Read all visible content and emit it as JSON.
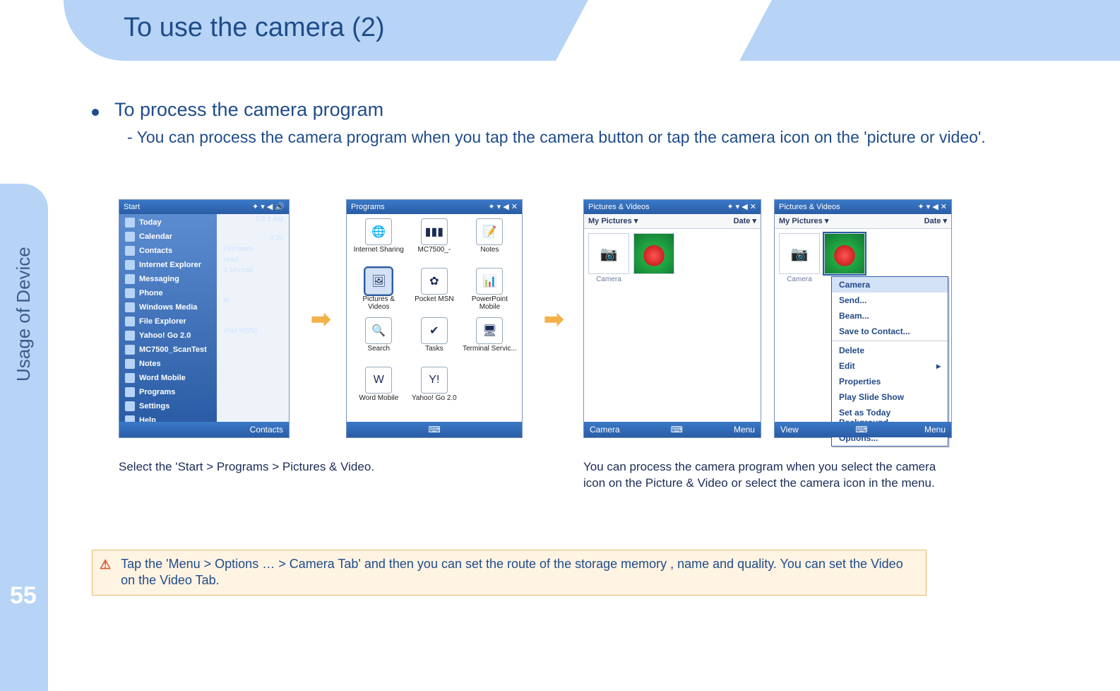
{
  "side": {
    "label": "Usage of Device",
    "page": "55"
  },
  "header": {
    "title": "To use the camera (2)"
  },
  "bullet": {
    "heading": "To process the camera program"
  },
  "subline": "- You can process the camera program when you tap the camera button or tap the camera icon on the 'picture or video'.",
  "shots": {
    "start": {
      "title": "Start",
      "status_icons": "✦ ▾ ◀ 🔊",
      "items": [
        "Today",
        "Calendar",
        "Contacts",
        "Internet Explorer",
        "Messaging",
        "Phone",
        "Windows Media",
        "File Explorer",
        "Yahoo! Go 2.0",
        "MC7500_ScanTest",
        "Notes",
        "Word Mobile",
        "Programs",
        "Settings",
        "Help"
      ],
      "right_hints": [
        "1/2 1 AM",
        "0:20",
        "Firmware",
        "read",
        "1 Unread",
        "ts",
        "chet MSN)"
      ],
      "bottom": "Contacts"
    },
    "programs": {
      "title": "Programs",
      "status_icons": "✦ ▾ ◀ ✕",
      "apps": [
        {
          "lbl": "Internet Sharing",
          "glyph": "🌐"
        },
        {
          "lbl": "MC7500_-",
          "glyph": "▮▮▮"
        },
        {
          "lbl": "Notes",
          "glyph": "📝"
        },
        {
          "lbl": "Pictures & Videos",
          "glyph": "🖼",
          "selected": true
        },
        {
          "lbl": "Pocket MSN",
          "glyph": "✿"
        },
        {
          "lbl": "PowerPoint Mobile",
          "glyph": "📊"
        },
        {
          "lbl": "Search",
          "glyph": "🔍"
        },
        {
          "lbl": "Tasks",
          "glyph": "✔"
        },
        {
          "lbl": "Terminal Servic...",
          "glyph": "🖥"
        },
        {
          "lbl": "Word Mobile",
          "glyph": "W"
        },
        {
          "lbl": "Yahoo! Go 2.0",
          "glyph": "Y!"
        }
      ]
    },
    "pv1": {
      "title": "Pictures & Videos",
      "status_icons": "✦ ▾ ◀ ✕",
      "folder": "My Pictures",
      "sort": "Date",
      "camera_tile": "Camera",
      "bottom_left": "Camera",
      "bottom_right": "Menu"
    },
    "pv2": {
      "title": "Pictures & Videos",
      "status_icons": "✦ ▾ ◀ ✕",
      "folder": "My Pictures",
      "sort": "Date",
      "camera_tile": "Camera",
      "bottom_left": "View",
      "bottom_right": "Menu",
      "menu": [
        "Camera",
        "Send...",
        "Beam...",
        "Save to Contact...",
        "Delete",
        "Edit",
        "Properties",
        "Play Slide Show",
        "Set as Today Background...",
        "Options..."
      ]
    }
  },
  "captions": {
    "left": "Select the 'Start > Programs > Pictures & Video.",
    "right": "You can process the camera program when you select the camera icon on the Picture & Video or select the camera icon in the menu."
  },
  "warn": {
    "icon": "⚠",
    "text": "Tap the 'Menu > Options … > Camera Tab' and then you can set the route of the storage memory , name and quality. You can set the Video on the Video Tab."
  }
}
